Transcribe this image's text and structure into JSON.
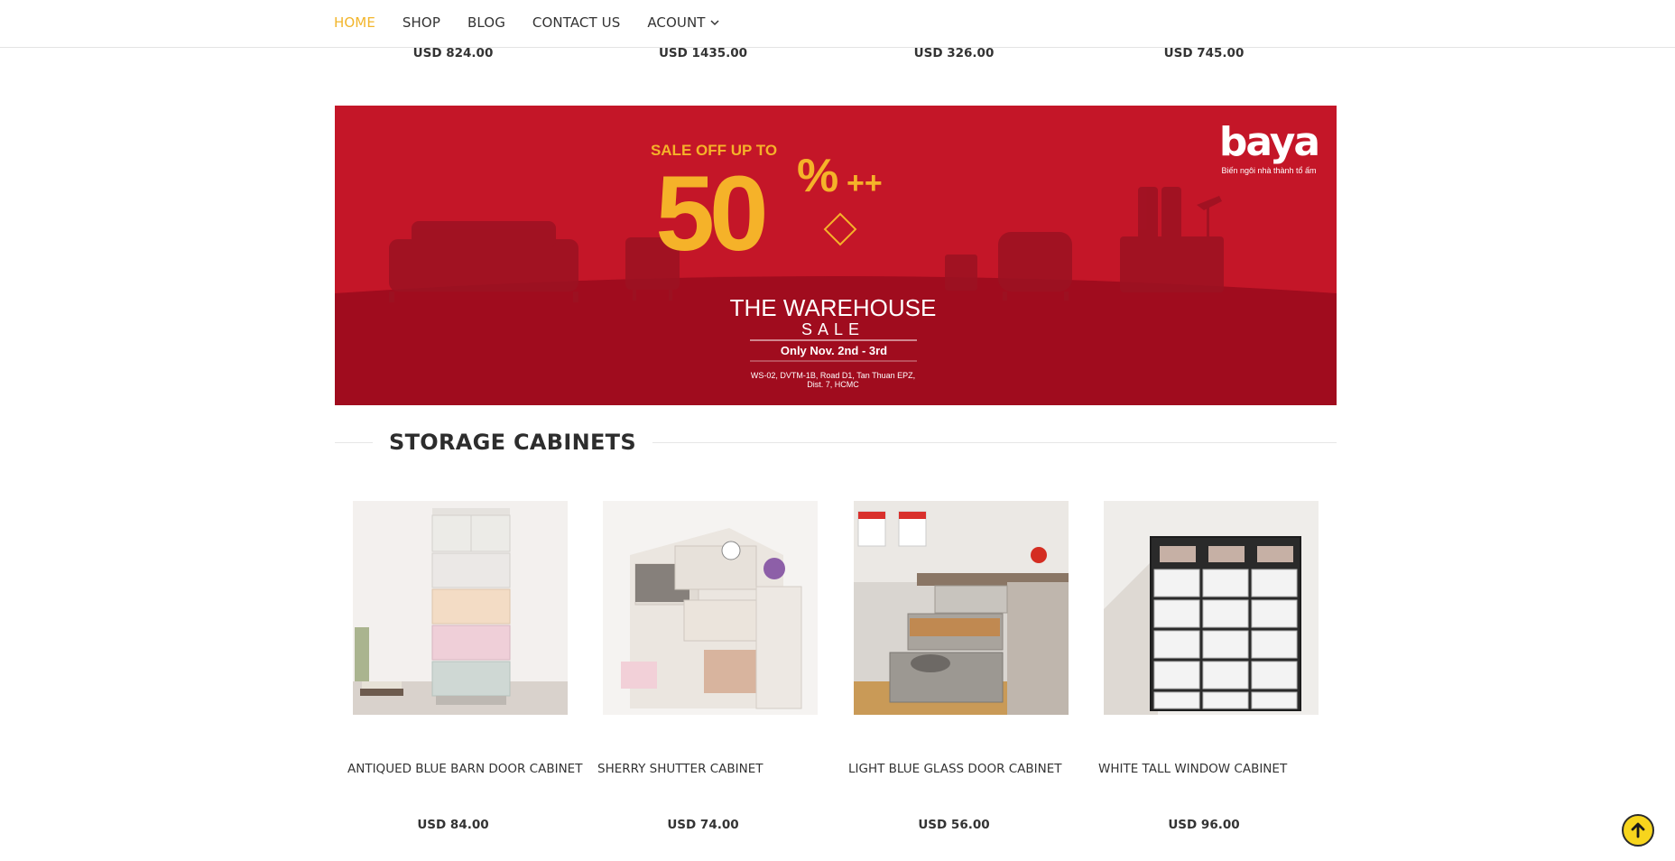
{
  "nav": {
    "items": [
      {
        "label": "HOME",
        "active": true
      },
      {
        "label": "SHOP",
        "active": false
      },
      {
        "label": "BLOG",
        "active": false
      },
      {
        "label": "CONTACT US",
        "active": false
      },
      {
        "label": "ACOUNT",
        "active": false,
        "dropdown": true
      }
    ]
  },
  "top_prices": [
    "USD 824.00",
    "USD 1435.00",
    "USD 326.00",
    "USD 745.00"
  ],
  "banner": {
    "headline": "SALE OFF UP TO",
    "percent": "50",
    "percent_sign": "%",
    "plus": "++",
    "title_line1": "THE WAREHOUSE",
    "title_line2": "SALE",
    "dates": "Only Nov. 2nd - 3rd",
    "address_line1": "WS-02, DVTM-1B, Road D1, Tan Thuan EPZ,",
    "address_line2": "Dist. 7, HCMC",
    "brand": "baya",
    "brand_tagline": "Biến ngôi nhà thành tổ ấm",
    "colors": {
      "background": "#c41628",
      "accent": "#f5b229"
    }
  },
  "section": {
    "title": "STORAGE CABINETS"
  },
  "products": [
    {
      "name": "ANTIQUED BLUE BARN DOOR CABINET",
      "price": "USD 84.00"
    },
    {
      "name": "SHERRY SHUTTER CABINET",
      "price": "USD 74.00"
    },
    {
      "name": "LIGHT BLUE GLASS DOOR CABINET",
      "price": "USD 56.00"
    },
    {
      "name": "WHITE TALL WINDOW CABINET",
      "price": "USD 96.00"
    }
  ],
  "colors": {
    "accent": "#f2b52b",
    "totop_bg": "#f7d51d"
  }
}
